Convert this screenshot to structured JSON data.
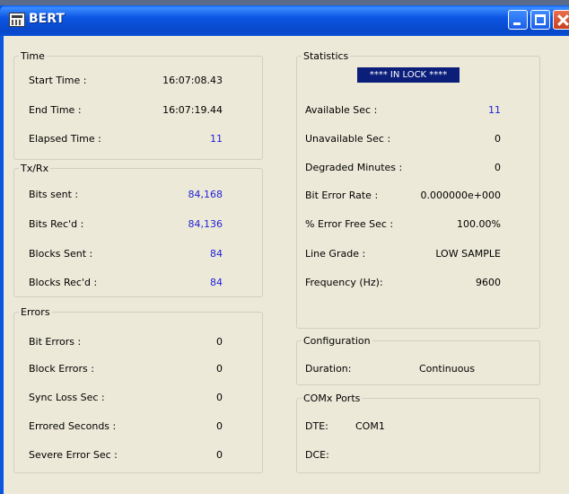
{
  "window": {
    "title": "BERT"
  },
  "time": {
    "legend": "Time",
    "rows": [
      {
        "label": "Start Time :",
        "value": "16:07:08.43"
      },
      {
        "label": "End Time :",
        "value": "16:07:19.44"
      },
      {
        "label": "Elapsed Time :",
        "value": "11"
      }
    ]
  },
  "txrx": {
    "legend": "Tx/Rx",
    "rows": [
      {
        "label": "Bits sent :",
        "value": "84,168"
      },
      {
        "label": "Bits Rec'd :",
        "value": "84,136"
      },
      {
        "label": "Blocks Sent :",
        "value": "84"
      },
      {
        "label": "Blocks Rec'd :",
        "value": "84"
      }
    ]
  },
  "errors": {
    "legend": "Errors",
    "rows": [
      {
        "label": "Bit Errors :",
        "value": "0"
      },
      {
        "label": "Block Errors :",
        "value": "0"
      },
      {
        "label": "Sync Loss Sec :",
        "value": "0"
      },
      {
        "label": "Errored Seconds :",
        "value": "0"
      },
      {
        "label": "Severe Error Sec :",
        "value": "0"
      }
    ]
  },
  "statistics": {
    "legend": "Statistics",
    "lock_status": "**** IN LOCK ****",
    "rows": [
      {
        "label": "Available Sec :",
        "value": "11"
      },
      {
        "label": "Unavailable Sec :",
        "value": "0"
      },
      {
        "label": "Degraded Minutes :",
        "value": "0"
      },
      {
        "label": "Bit Error Rate :",
        "value": "0.000000e+000"
      },
      {
        "label": "% Error Free Sec :",
        "value": "100.00%"
      },
      {
        "label": "Line Grade :",
        "value": "LOW SAMPLE"
      },
      {
        "label": "Frequency (Hz):",
        "value": "9600"
      }
    ]
  },
  "configuration": {
    "legend": "Configuration",
    "duration_label": "Duration:",
    "duration_value": "Continuous"
  },
  "comx": {
    "legend": "COMx Ports",
    "dte_label": "DTE:",
    "dte_value": "COM1",
    "dce_label": "DCE:",
    "dce_value": ""
  },
  "colors": {
    "value_blue": "#1f1fd8",
    "lock_bg": "#0b1e7a"
  }
}
